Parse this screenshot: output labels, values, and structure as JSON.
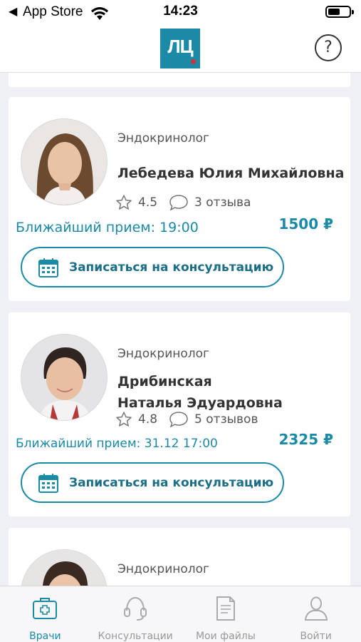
{
  "status_bar": {
    "back": "◀",
    "carrier": "App Store",
    "time": "14:23"
  },
  "header": {
    "logo_text": "ЛЦ",
    "help_label": "?"
  },
  "doctors": [
    {
      "specialty": "Эндокринолог",
      "name": "Лебедева Юлия Михайловна",
      "rating": "4.5",
      "reviews": "3 отзыва",
      "next_appointment": "Ближайший прием: 19:00",
      "price": "1500 ₽",
      "book_label": "Записаться на консультацию"
    },
    {
      "specialty": "Эндокринолог",
      "name_line1": "Дрибинская",
      "name_line2": "Наталья Эдуардовна",
      "rating": "4.8",
      "reviews": "5 отзывов",
      "next_appointment": "Ближайший прием: 31.12 17:00",
      "price": "2325 ₽",
      "book_label": "Записаться на консультацию"
    },
    {
      "specialty": "Эндокринолог"
    }
  ],
  "tabs": [
    {
      "label": "Врачи",
      "icon": "doctor-bag-icon",
      "active": true
    },
    {
      "label": "Консультации",
      "icon": "headset-icon"
    },
    {
      "label": "Мои файлы",
      "icon": "document-icon"
    },
    {
      "label": "Войти",
      "icon": "person-icon"
    }
  ],
  "colors": {
    "accent": "#1a8aa6",
    "background": "#eef0f5",
    "logo_dot": "#d3303c"
  }
}
